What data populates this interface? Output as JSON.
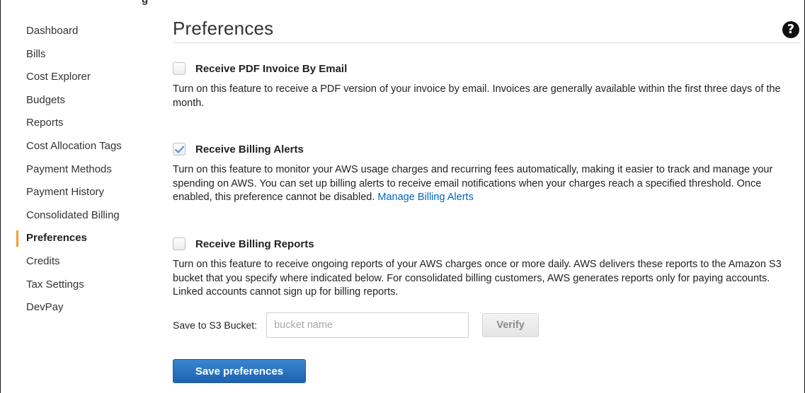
{
  "sidebar": {
    "items": [
      {
        "label": "Dashboard",
        "active": false
      },
      {
        "label": "Bills",
        "active": false
      },
      {
        "label": "Cost Explorer",
        "active": false
      },
      {
        "label": "Budgets",
        "active": false
      },
      {
        "label": "Reports",
        "active": false
      },
      {
        "label": "Cost Allocation Tags",
        "active": false
      },
      {
        "label": "Payment Methods",
        "active": false
      },
      {
        "label": "Payment History",
        "active": false
      },
      {
        "label": "Consolidated Billing",
        "active": false
      },
      {
        "label": "Preferences",
        "active": true
      },
      {
        "label": "Credits",
        "active": false
      },
      {
        "label": "Tax Settings",
        "active": false
      },
      {
        "label": "DevPay",
        "active": false
      }
    ],
    "accent_color": "#f0a02a"
  },
  "header": {
    "title": "Preferences",
    "help_icon": "question-circle-icon",
    "top_fragment": "g"
  },
  "preferences": {
    "pdf_invoice": {
      "label": "Receive PDF Invoice By Email",
      "checked": false,
      "description": "Turn on this feature to receive a PDF version of your invoice by email. Invoices are generally available within the first three days of the month."
    },
    "billing_alerts": {
      "label": "Receive Billing Alerts",
      "checked": true,
      "description": "Turn on this feature to monitor your AWS usage charges and recurring fees automatically, making it easier to track and manage your spending on AWS. You can set up billing alerts to receive email notifications when your charges reach a specified threshold. Once enabled, this preference cannot be disabled.",
      "link_label": "Manage Billing Alerts"
    },
    "billing_reports": {
      "label": "Receive Billing Reports",
      "checked": false,
      "description": "Turn on this feature to receive ongoing reports of your AWS charges once or more daily. AWS delivers these reports to the Amazon S3 bucket that you specify where indicated below. For consolidated billing customers, AWS generates reports only for paying accounts. Linked accounts cannot sign up for billing reports."
    }
  },
  "bucket": {
    "label": "Save to S3 Bucket:",
    "value": "",
    "placeholder": "bucket name",
    "verify_label": "Verify"
  },
  "actions": {
    "save_label": "Save preferences",
    "save_color": "#1e62b0",
    "link_color": "#0066c0",
    "check_color": "#5b9bd5"
  }
}
